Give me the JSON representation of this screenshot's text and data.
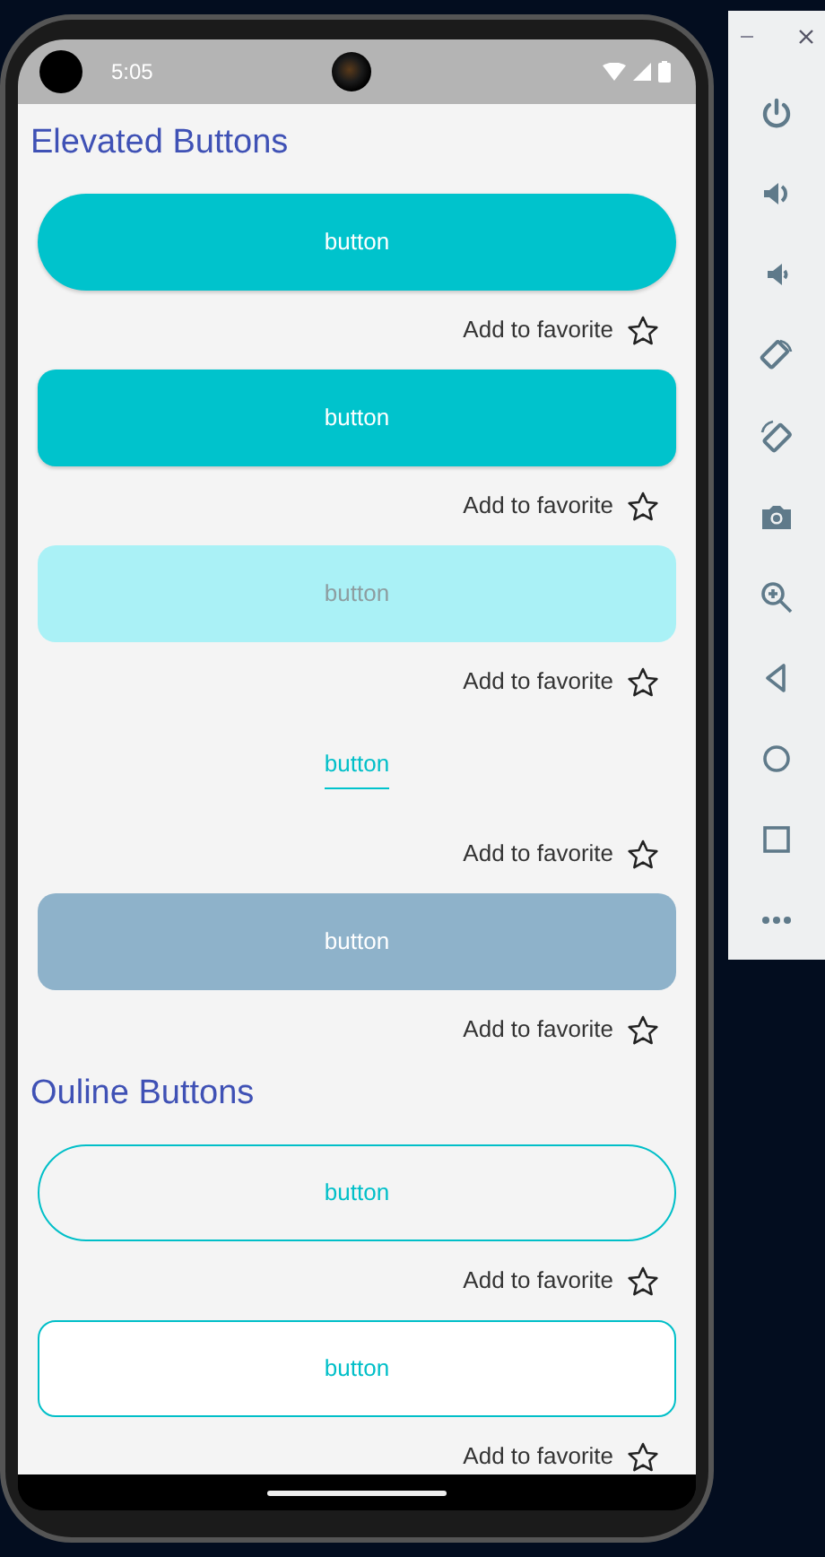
{
  "status_bar": {
    "time": "5:05"
  },
  "sections": [
    {
      "title": "Elevated Buttons",
      "items": [
        {
          "kind": "filled-pill",
          "label": "button",
          "favorite": {
            "label": "Add to favorite",
            "starred": false
          }
        },
        {
          "kind": "filled",
          "label": "button",
          "favorite": {
            "label": "Add to favorite",
            "starred": false
          }
        },
        {
          "kind": "light",
          "label": "button",
          "favorite": {
            "label": "Add to favorite",
            "starred": false
          }
        },
        {
          "kind": "text",
          "label": "button",
          "favorite": {
            "label": "Add to favorite",
            "starred": false
          }
        },
        {
          "kind": "muted",
          "label": "button",
          "favorite": {
            "label": "Add to favorite",
            "starred": false
          }
        }
      ]
    },
    {
      "title": "Ouline Buttons",
      "items": [
        {
          "kind": "outline-pill",
          "label": "button",
          "favorite": {
            "label": "Add to favorite",
            "starred": false
          }
        },
        {
          "kind": "outline",
          "label": "button",
          "favorite": {
            "label": "Add to favorite",
            "starred": false
          }
        }
      ]
    }
  ]
}
